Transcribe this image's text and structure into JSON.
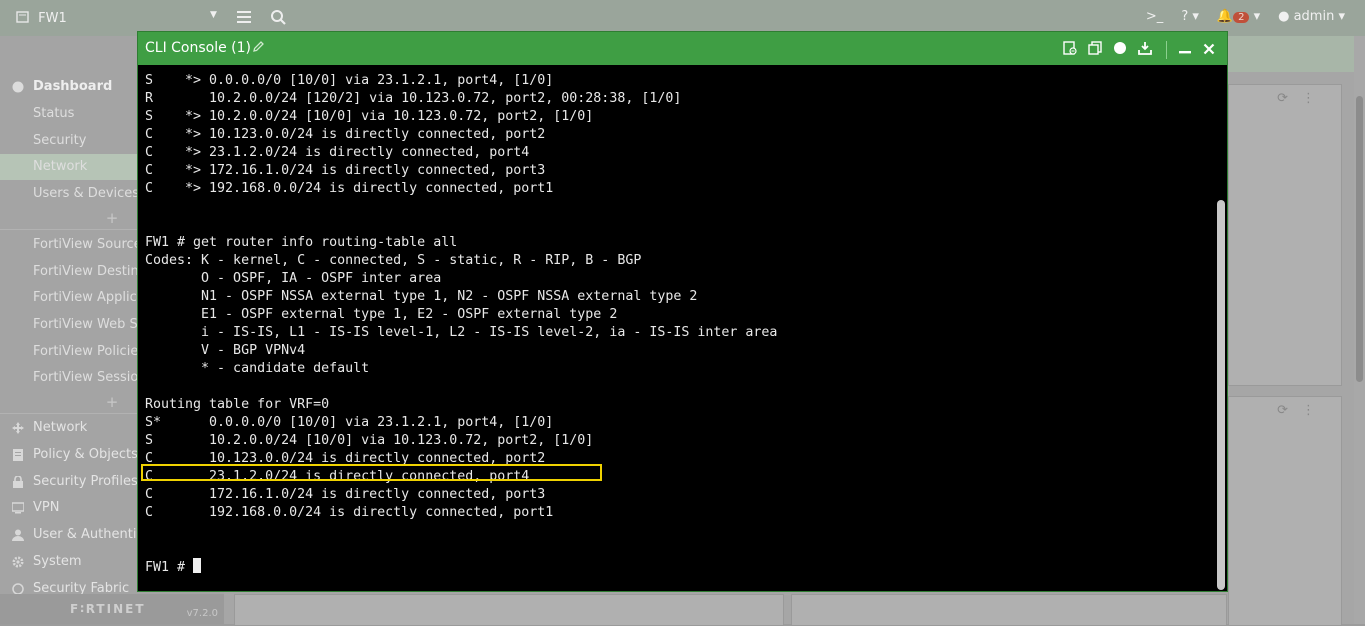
{
  "topbar": {
    "hostname": "FW1",
    "notifications_count": "2",
    "user": "admin"
  },
  "sidebar": {
    "groups": [
      {
        "label": "Dashboard"
      },
      {
        "label": "Status"
      },
      {
        "label": "Security"
      },
      {
        "label": "Network"
      },
      {
        "label": "Users & Devices"
      },
      {
        "label": "FortiView Sources"
      },
      {
        "label": "FortiView Destinations"
      },
      {
        "label": "FortiView Applications"
      },
      {
        "label": "FortiView Web Sites"
      },
      {
        "label": "FortiView Policies"
      },
      {
        "label": "FortiView Sessions"
      },
      {
        "label": "Network"
      },
      {
        "label": "Policy & Objects"
      },
      {
        "label": "Security Profiles"
      },
      {
        "label": "VPN"
      },
      {
        "label": "User & Authentication"
      },
      {
        "label": "System"
      },
      {
        "label": "Security Fabric"
      }
    ],
    "brand": "F∶RTINET",
    "version": "v7.2.0"
  },
  "console": {
    "title": "CLI Console (1)",
    "lines": [
      "S    *> 0.0.0.0/0 [10/0] via 23.1.2.1, port4, [1/0]",
      "R       10.2.0.0/24 [120/2] via 10.123.0.72, port2, 00:28:38, [1/0]",
      "S    *> 10.2.0.0/24 [10/0] via 10.123.0.72, port2, [1/0]",
      "C    *> 10.123.0.0/24 is directly connected, port2",
      "C    *> 23.1.2.0/24 is directly connected, port4",
      "C    *> 172.16.1.0/24 is directly connected, port3",
      "C    *> 192.168.0.0/24 is directly connected, port1",
      "",
      "",
      "FW1 # get router info routing-table all",
      "Codes: K - kernel, C - connected, S - static, R - RIP, B - BGP",
      "       O - OSPF, IA - OSPF inter area",
      "       N1 - OSPF NSSA external type 1, N2 - OSPF NSSA external type 2",
      "       E1 - OSPF external type 1, E2 - OSPF external type 2",
      "       i - IS-IS, L1 - IS-IS level-1, L2 - IS-IS level-2, ia - IS-IS inter area",
      "       V - BGP VPNv4",
      "       * - candidate default",
      "",
      "Routing table for VRF=0",
      "S*      0.0.0.0/0 [10/0] via 23.1.2.1, port4, [1/0]",
      "S       10.2.0.0/24 [10/0] via 10.123.0.72, port2, [1/0]",
      "C       10.123.0.0/24 is directly connected, port2",
      "C       23.1.2.0/24 is directly connected, port4",
      "C       172.16.1.0/24 is directly connected, port3",
      "C       192.168.0.0/24 is directly connected, port1",
      "",
      "",
      "FW1 # "
    ]
  },
  "colors": {
    "console_titlebar": "#3f9e44",
    "highlight": "#f0d200"
  }
}
